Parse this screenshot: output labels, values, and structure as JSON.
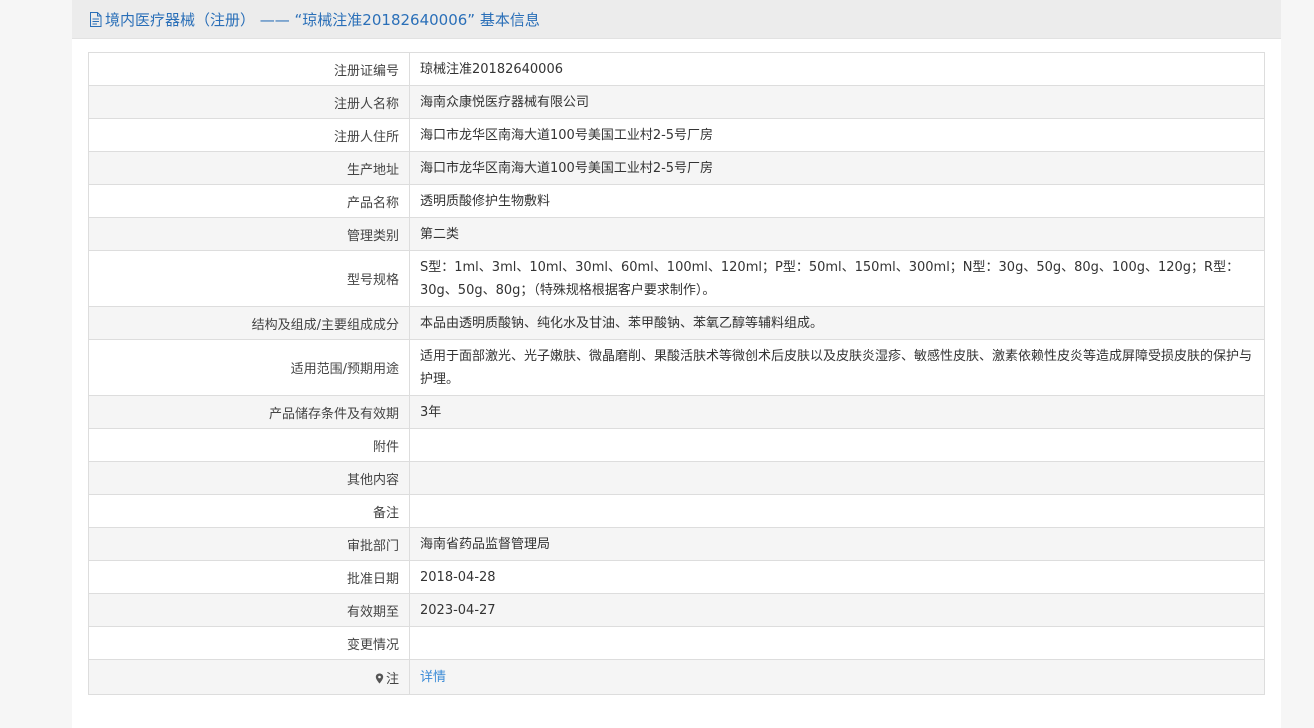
{
  "header": {
    "icon": "document-icon",
    "title": "境内医疗器械（注册） —— “琼械注准20182640006” 基本信息"
  },
  "rows": [
    {
      "label": "注册证编号",
      "value": "琼械注准20182640006"
    },
    {
      "label": "注册人名称",
      "value": "海南众康悦医疗器械有限公司"
    },
    {
      "label": "注册人住所",
      "value": "海口市龙华区南海大道100号美国工业村2-5号厂房"
    },
    {
      "label": "生产地址",
      "value": "海口市龙华区南海大道100号美国工业村2-5号厂房"
    },
    {
      "label": "产品名称",
      "value": "透明质酸修护生物敷料"
    },
    {
      "label": "管理类别",
      "value": "第二类"
    },
    {
      "label": "型号规格",
      "value": "S型：1ml、3ml、10ml、30ml、60ml、100ml、120ml；P型：50ml、150ml、300ml；N型：30g、50g、80g、100g、120g；R型：30g、50g、80g；（特殊规格根据客户要求制作）。"
    },
    {
      "label": "结构及组成/主要组成成分",
      "value": "本品由透明质酸钠、纯化水及甘油、苯甲酸钠、苯氧乙醇等辅料组成。"
    },
    {
      "label": "适用范围/预期用途",
      "value": "适用于面部激光、光子嫩肤、微晶磨削、果酸活肤术等微创术后皮肤以及皮肤炎湿疹、敏感性皮肤、激素依赖性皮炎等造成屏障受损皮肤的保护与护理。"
    },
    {
      "label": "产品储存条件及有效期",
      "value": "3年"
    },
    {
      "label": "附件",
      "value": ""
    },
    {
      "label": "其他内容",
      "value": ""
    },
    {
      "label": "备注",
      "value": ""
    },
    {
      "label": "审批部门",
      "value": "海南省药品监督管理局"
    },
    {
      "label": "批准日期",
      "value": "2018-04-28"
    },
    {
      "label": "有效期至",
      "value": "2023-04-27"
    },
    {
      "label": "变更情况",
      "value": ""
    }
  ],
  "note_row": {
    "icon": "pin-icon",
    "label": "注",
    "link_text": "详情"
  },
  "colors": {
    "title": "#2a6fb8",
    "link": "#3b8bd6",
    "header_bg": "#ececec",
    "stripe": "#f5f5f5",
    "border": "#dddddd"
  }
}
